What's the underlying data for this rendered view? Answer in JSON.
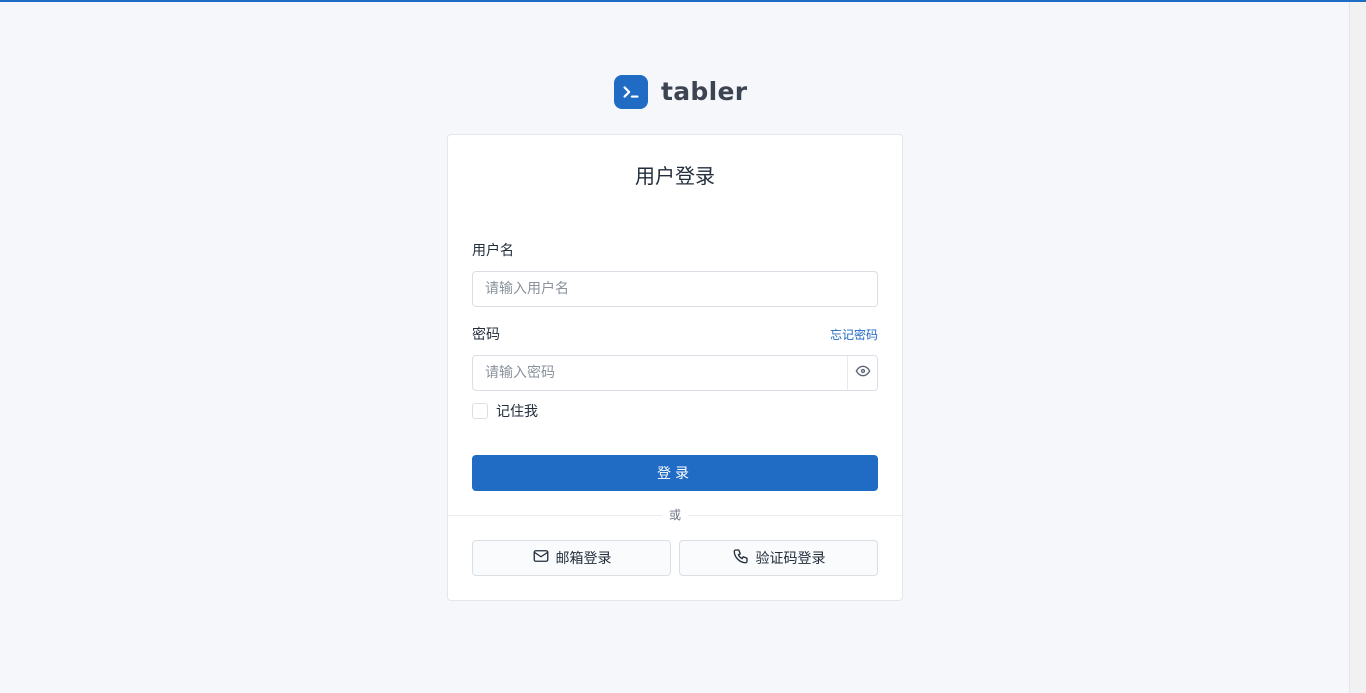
{
  "brand": {
    "name": "tabler",
    "icon": "terminal-prompt-icon",
    "accent_color": "#206bc4"
  },
  "login_card": {
    "title": "用户登录",
    "username": {
      "label": "用户名",
      "placeholder": "请输入用户名",
      "value": ""
    },
    "password": {
      "label": "密码",
      "placeholder": "请输入密码",
      "value": "",
      "forgot_link": "忘记密码",
      "toggle_icon": "eye-icon"
    },
    "remember_me": {
      "label": "记住我",
      "checked": false
    },
    "submit_label": "登录",
    "divider_text": "或",
    "alt_logins": [
      {
        "label": "邮箱登录",
        "icon": "mail-icon"
      },
      {
        "label": "验证码登录",
        "icon": "phone-icon"
      }
    ]
  }
}
